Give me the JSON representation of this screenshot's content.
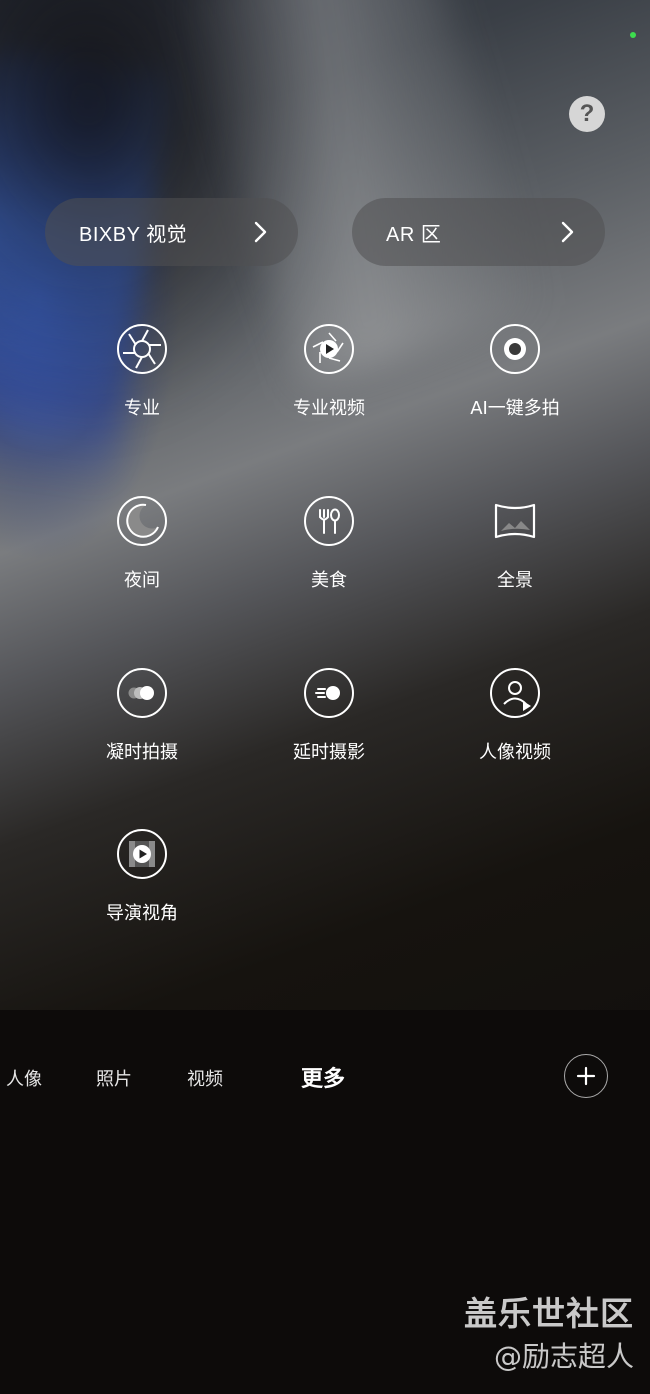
{
  "header": {
    "help_label": "?"
  },
  "shortcuts": {
    "bixby_label": "BIXBY 视觉",
    "ar_label": "AR 区"
  },
  "modes": [
    {
      "label": "专业",
      "icon": "aperture-icon"
    },
    {
      "label": "专业视频",
      "icon": "aperture-play-icon"
    },
    {
      "label": "AI一键多拍",
      "icon": "record-icon"
    },
    {
      "label": "夜间",
      "icon": "moon-icon"
    },
    {
      "label": "美食",
      "icon": "fork-spoon-icon"
    },
    {
      "label": "全景",
      "icon": "panorama-icon"
    },
    {
      "label": "凝时拍摄",
      "icon": "hyperlapse-icon"
    },
    {
      "label": "延时摄影",
      "icon": "motion-blur-icon"
    },
    {
      "label": "人像视频",
      "icon": "portrait-video-icon"
    },
    {
      "label": "导演视角",
      "icon": "director-view-icon"
    }
  ],
  "bottom_tabs": [
    {
      "label": "人像"
    },
    {
      "label": "照片"
    },
    {
      "label": "视频"
    },
    {
      "label": "更多",
      "active": true
    }
  ],
  "add_button_icon": "plus-icon",
  "watermark": {
    "line1": "盖乐世社区",
    "line2": "@励志超人"
  },
  "colors": {
    "status_dot": "#3ddc4e",
    "pill_bg": "rgba(80,80,82,0.55)",
    "help_bg": "#d6d6d6"
  }
}
